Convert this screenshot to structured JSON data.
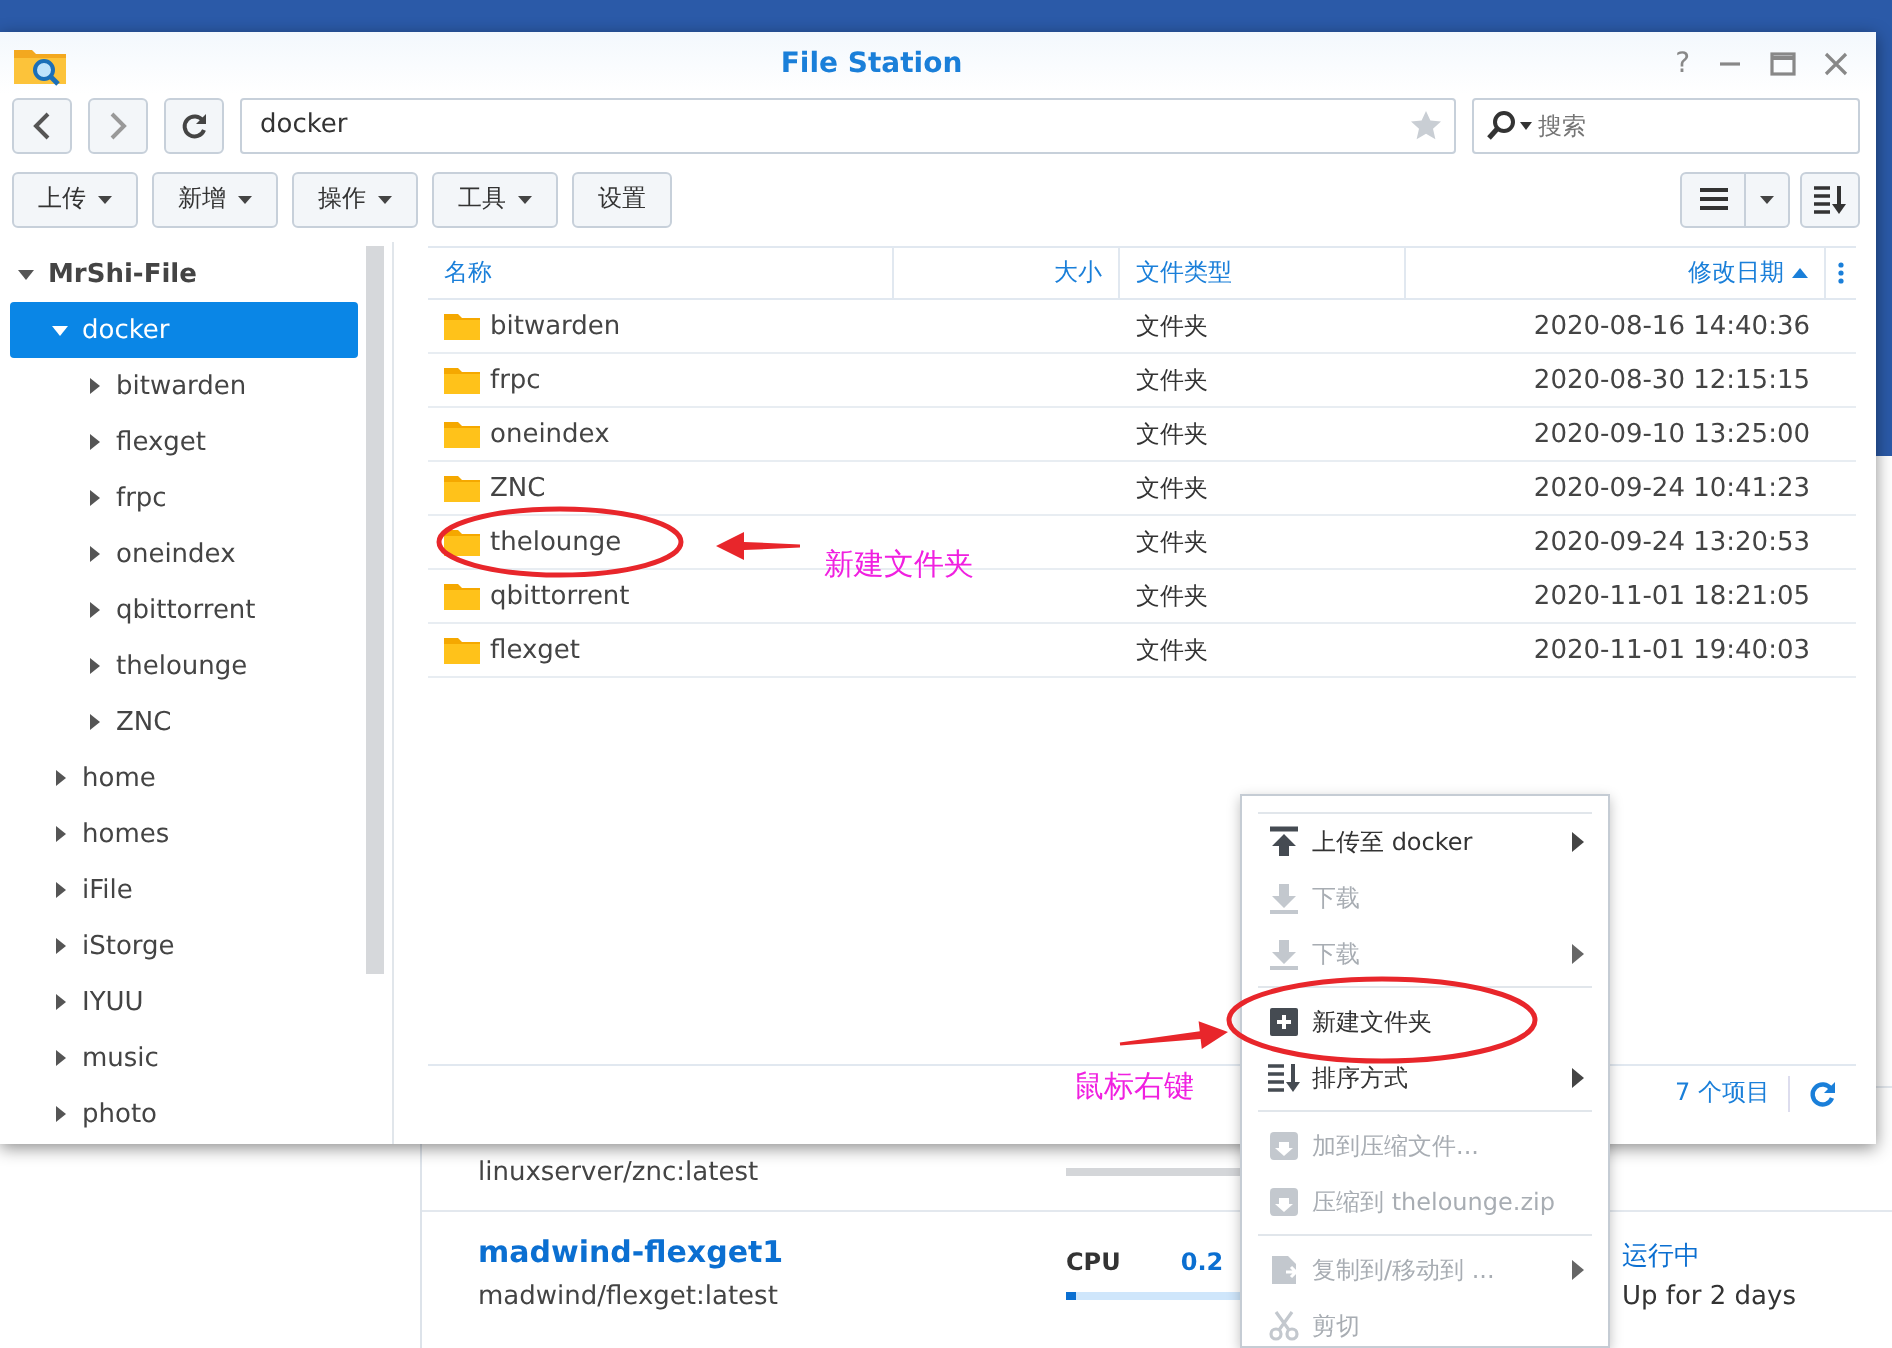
{
  "window": {
    "title": "File Station",
    "help": "?"
  },
  "nav": {
    "path": "docker",
    "search_placeholder": "搜索"
  },
  "toolbar": {
    "buttons": [
      {
        "label": "上传",
        "dropdown": true
      },
      {
        "label": "新增",
        "dropdown": true
      },
      {
        "label": "操作",
        "dropdown": true
      },
      {
        "label": "工具",
        "dropdown": true
      },
      {
        "label": "设置",
        "dropdown": false
      }
    ]
  },
  "sidebar": {
    "tree": [
      {
        "label": "MrShi-File",
        "expanded": true,
        "selected": false,
        "children": [
          {
            "label": "docker",
            "expanded": true,
            "selected": true,
            "children": [
              {
                "label": "bitwarden",
                "expanded": false,
                "selected": false
              },
              {
                "label": "flexget",
                "expanded": false,
                "selected": false
              },
              {
                "label": "frpc",
                "expanded": false,
                "selected": false
              },
              {
                "label": "oneindex",
                "expanded": false,
                "selected": false
              },
              {
                "label": "qbittorrent",
                "expanded": false,
                "selected": false
              },
              {
                "label": "thelounge",
                "expanded": false,
                "selected": false
              },
              {
                "label": "ZNC",
                "expanded": false,
                "selected": false
              }
            ]
          },
          {
            "label": "home",
            "expanded": false,
            "selected": false
          },
          {
            "label": "homes",
            "expanded": false,
            "selected": false
          },
          {
            "label": "iFile",
            "expanded": false,
            "selected": false
          },
          {
            "label": "iStorge",
            "expanded": false,
            "selected": false
          },
          {
            "label": "IYUU",
            "expanded": false,
            "selected": false
          },
          {
            "label": "music",
            "expanded": false,
            "selected": false
          },
          {
            "label": "photo",
            "expanded": false,
            "selected": false
          }
        ]
      }
    ]
  },
  "table": {
    "columns": [
      {
        "label": "名称",
        "sorted": false
      },
      {
        "label": "大小",
        "sorted": false
      },
      {
        "label": "文件类型",
        "sorted": false
      },
      {
        "label": "修改日期",
        "sorted": true
      }
    ],
    "rows": [
      {
        "name": "bitwarden",
        "type": "文件夹",
        "modified": "2020-08-16 14:40:36"
      },
      {
        "name": "frpc",
        "type": "文件夹",
        "modified": "2020-08-30 12:15:15"
      },
      {
        "name": "oneindex",
        "type": "文件夹",
        "modified": "2020-09-10 13:25:00"
      },
      {
        "name": "ZNC",
        "type": "文件夹",
        "modified": "2020-09-24 10:41:23"
      },
      {
        "name": "thelounge",
        "type": "文件夹",
        "modified": "2020-09-24 13:20:53"
      },
      {
        "name": "qbittorrent",
        "type": "文件夹",
        "modified": "2020-11-01 18:21:05"
      },
      {
        "name": "flexget",
        "type": "文件夹",
        "modified": "2020-11-01 19:40:03"
      }
    ]
  },
  "footer": {
    "count": "7 个项目"
  },
  "context_menu": {
    "items": [
      {
        "kind": "item",
        "label": "上传至 docker",
        "disabled": false,
        "submenu": true
      },
      {
        "kind": "item",
        "label": "下载",
        "disabled": true,
        "submenu": false
      },
      {
        "kind": "item",
        "label": "下载",
        "disabled": true,
        "submenu": true
      },
      {
        "kind": "separator"
      },
      {
        "kind": "item",
        "label": "新建文件夹",
        "disabled": false,
        "submenu": false
      },
      {
        "kind": "item",
        "label": "排序方式",
        "disabled": false,
        "submenu": true
      },
      {
        "kind": "separator"
      },
      {
        "kind": "item",
        "label": "加到压缩文件...",
        "disabled": true,
        "submenu": false
      },
      {
        "kind": "item",
        "label": "压缩到 thelounge.zip",
        "disabled": true,
        "submenu": false
      },
      {
        "kind": "separator"
      },
      {
        "kind": "item",
        "label": "复制到/移动到 ...",
        "disabled": true,
        "submenu": true
      },
      {
        "kind": "item",
        "label": "剪切",
        "disabled": true,
        "submenu": false
      }
    ]
  },
  "background_app": {
    "containers": [
      {
        "image": "linuxserver/znc:latest",
        "running": false
      },
      {
        "name": "madwind-flexget1",
        "image": "madwind/flexget:latest",
        "cpu_label": "CPU",
        "cpu_value": "0.2",
        "running": true,
        "cpu": {
          "level": 0.02
        },
        "status": "运行中",
        "uptime": "Up for 2 days"
      }
    ]
  },
  "annotations": [
    {
      "text": "新建文件夹"
    },
    {
      "text": "鼠标右键"
    }
  ]
}
